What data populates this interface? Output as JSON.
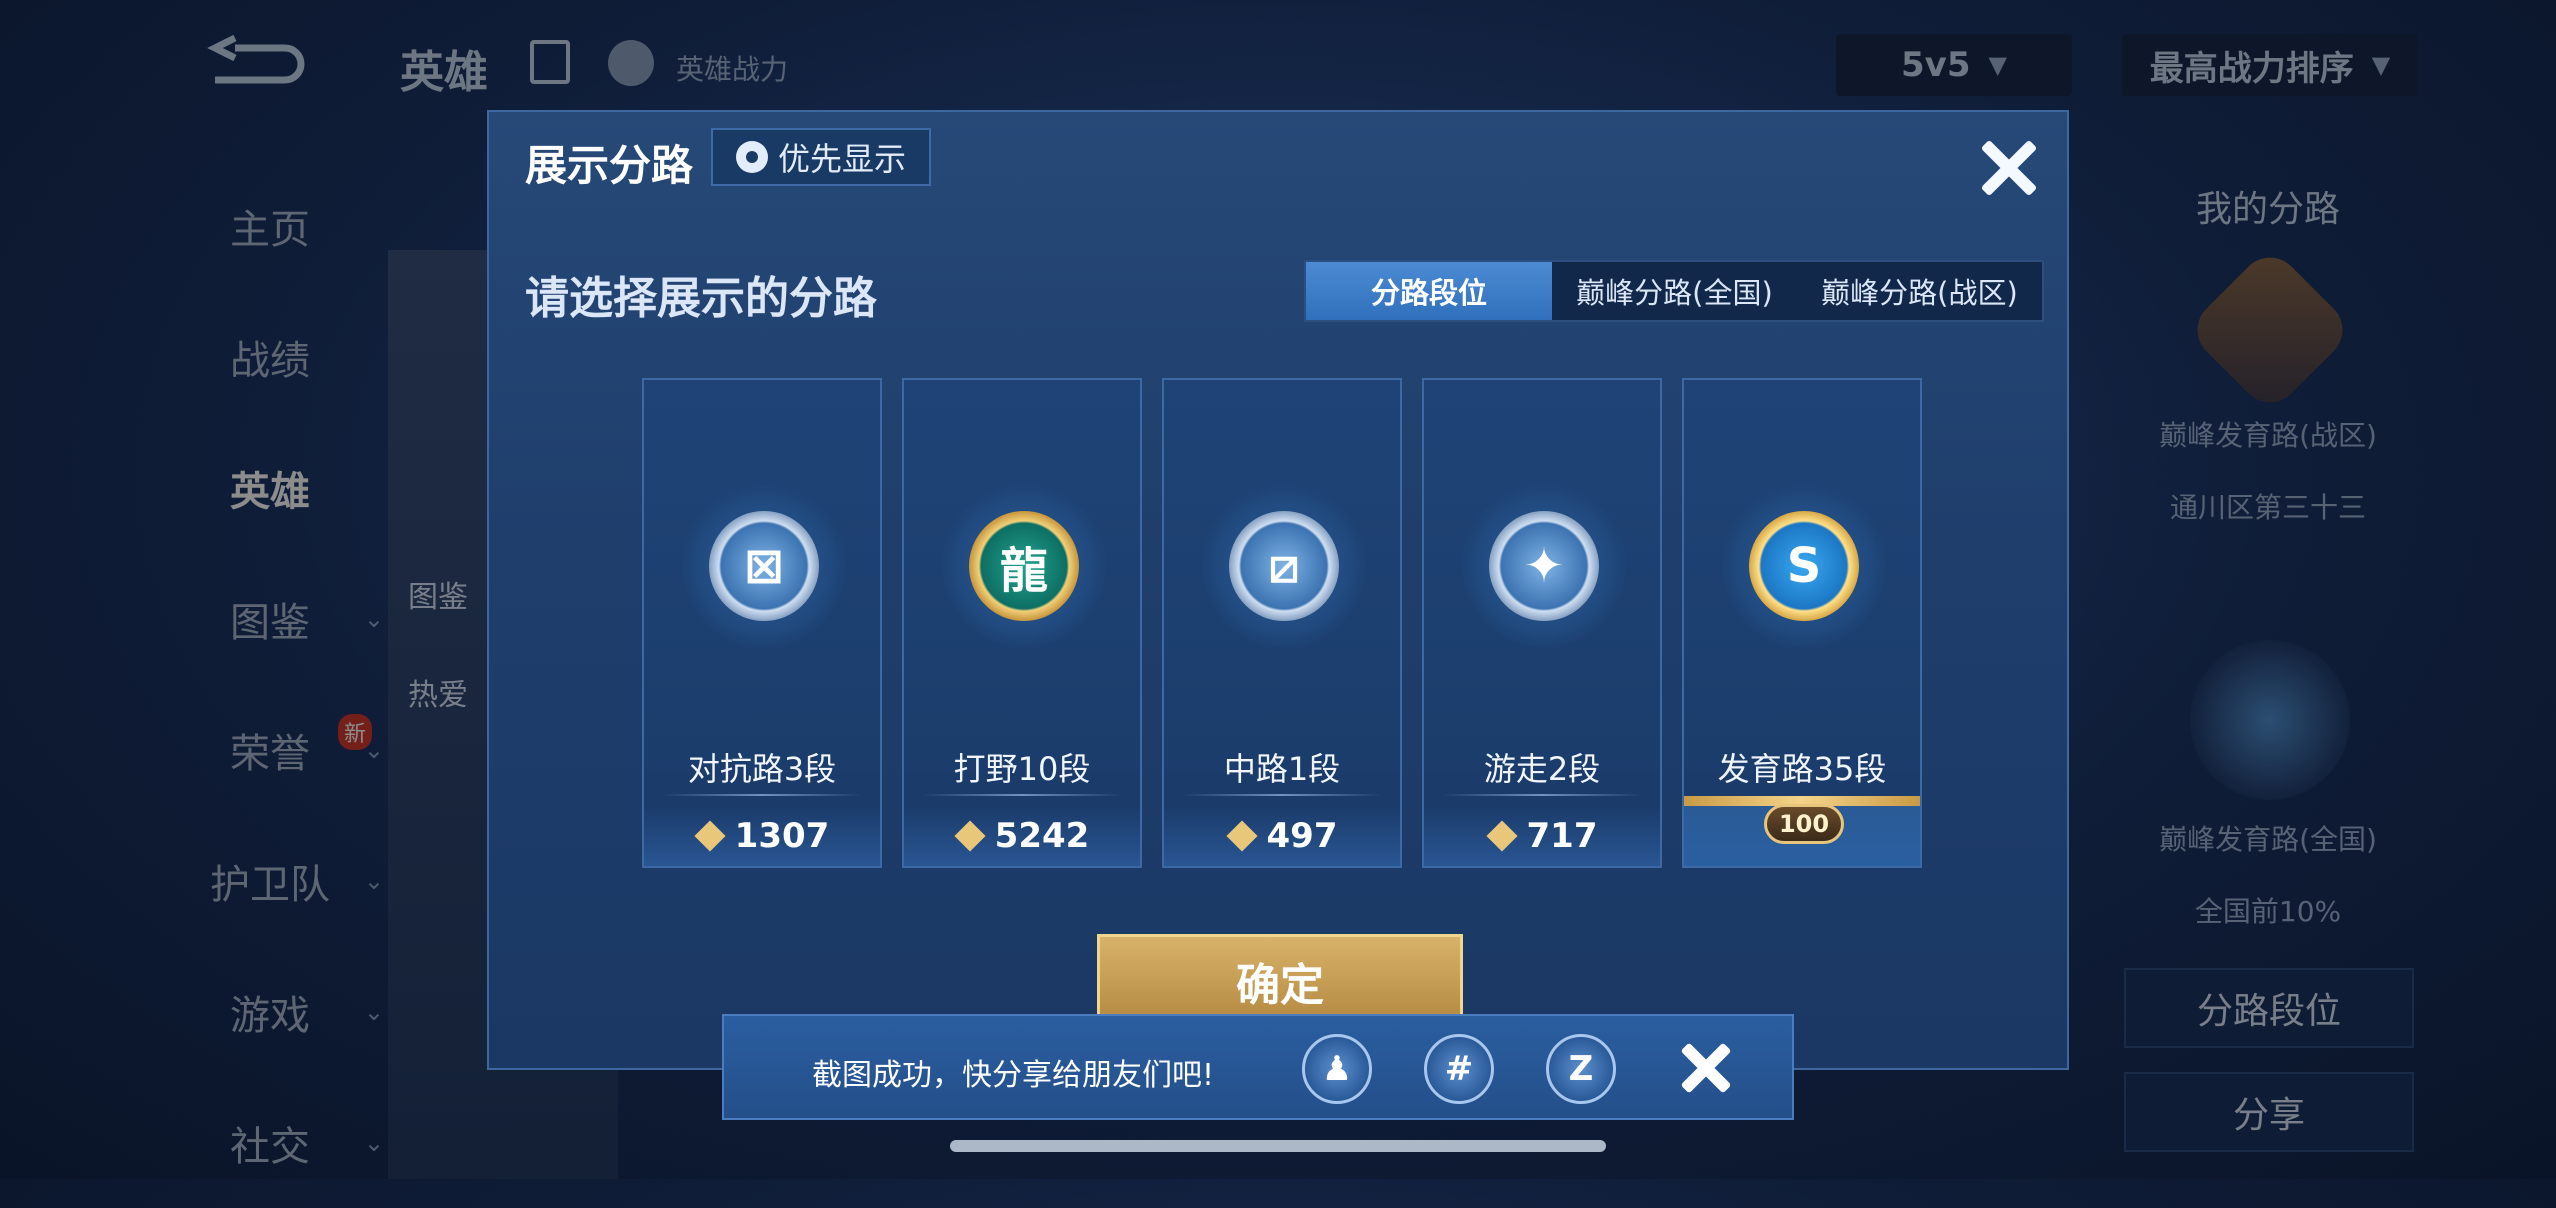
{
  "background": {
    "top_title": "英雄",
    "power_label": "英雄战力",
    "mode_select": "5v5",
    "sort_select": "最高战力排序",
    "nav": [
      {
        "label": "主页",
        "active": false
      },
      {
        "label": "战绩",
        "active": false
      },
      {
        "label": "英雄",
        "active": true
      },
      {
        "label": "图鉴",
        "active": false
      },
      {
        "label": "荣誉",
        "active": false
      },
      {
        "label": "护卫队",
        "active": false
      },
      {
        "label": "游戏",
        "active": false
      },
      {
        "label": "社交",
        "active": false
      }
    ],
    "new_badge": "新",
    "hero_card_labels": [
      "图鉴",
      "热爱"
    ],
    "right_panel": {
      "title": "我的分路",
      "lane1": "巅峰发育路(战区)",
      "lane1_region": "通川区第三十三",
      "lane2": "巅峰发育路(全国)",
      "lane2_rank": "全国前10%",
      "button1": "分路段位",
      "button2": "分享"
    }
  },
  "modal": {
    "title": "展示分路",
    "priority_button": "优先显示",
    "prompt": "请选择展示的分路",
    "tabs": [
      {
        "label": "分路段位",
        "active": true
      },
      {
        "label": "巅峰分路(全国)",
        "active": false
      },
      {
        "label": "巅峰分路(战区)",
        "active": false
      }
    ],
    "lanes": [
      {
        "label": "对抗路3段",
        "score": "1307",
        "icon": "clash-lane-emblem-icon",
        "style": "silver",
        "glyph": "⊠"
      },
      {
        "label": "打野10段",
        "score": "5242",
        "icon": "jungle-dragon-emblem-icon",
        "style": "gold",
        "glyph": "龍"
      },
      {
        "label": "中路1段",
        "score": "497",
        "icon": "mid-lane-emblem-icon",
        "style": "silver",
        "glyph": "⧄"
      },
      {
        "label": "游走2段",
        "score": "717",
        "icon": "roam-wings-emblem-icon",
        "style": "silver",
        "glyph": "✦"
      },
      {
        "label": "发育路35段",
        "peak_badge": "100",
        "icon": "farm-lane-emblem-icon",
        "style": "blue",
        "glyph": "S"
      }
    ],
    "confirm_button": "确定"
  },
  "toast": {
    "text": "截图成功，快分享给朋友们吧!",
    "share_icons": [
      {
        "name": "qq-share-icon",
        "glyph": "♟"
      },
      {
        "name": "wechat-moments-share-icon",
        "glyph": "#"
      },
      {
        "name": "qzone-share-icon",
        "glyph": "Z"
      }
    ]
  },
  "colors": {
    "accent_blue": "#3070bc",
    "gold": "#d8b26a",
    "modal_bg": "#264978"
  }
}
